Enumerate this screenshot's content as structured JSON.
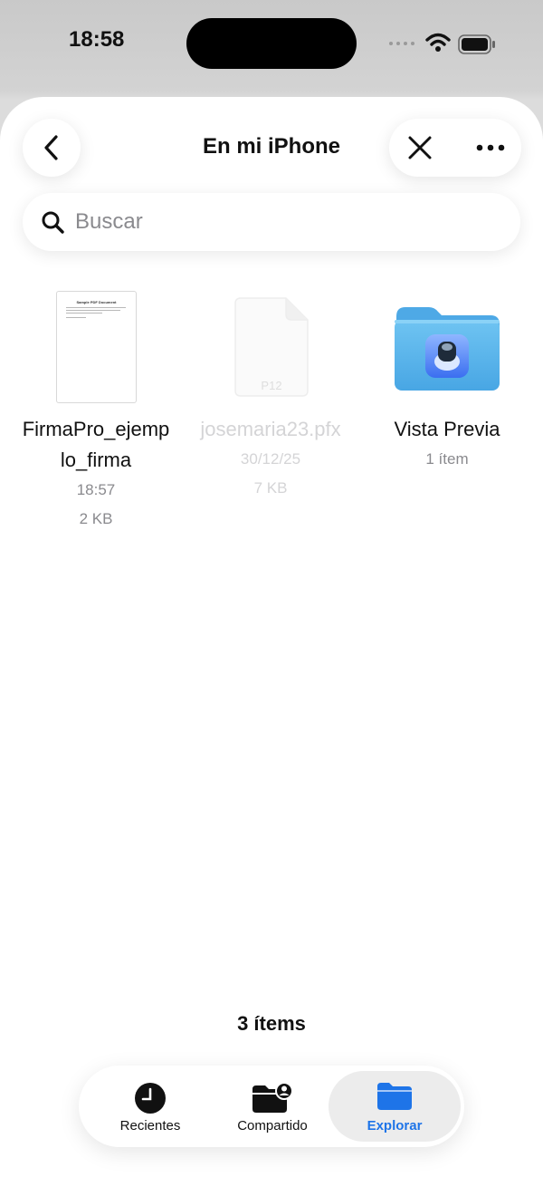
{
  "status_bar": {
    "time": "18:58"
  },
  "header": {
    "title": "En mi iPhone"
  },
  "search": {
    "placeholder": "Buscar"
  },
  "files": [
    {
      "name_line1": "FirmaPro_ejemp",
      "name_line2": "lo_firma",
      "modified": "18:57",
      "size": "2 KB",
      "thumb_title": "Sample PDF Document"
    },
    {
      "name": "josemaria23.pfx",
      "date": "30/12/25",
      "size": "7 KB",
      "thumb_label": "P12"
    },
    {
      "name": "Vista Previa",
      "items": "1 ítem"
    }
  ],
  "footer": {
    "item_count": "3 ítems"
  },
  "tabs": [
    {
      "label": "Recientes",
      "icon": "clock-icon"
    },
    {
      "label": "Compartido",
      "icon": "shared-folder-icon"
    },
    {
      "label": "Explorar",
      "icon": "folder-icon",
      "selected": true
    }
  ],
  "colors": {
    "accent": "#1e74e8",
    "folder": "#5ab6ee"
  }
}
